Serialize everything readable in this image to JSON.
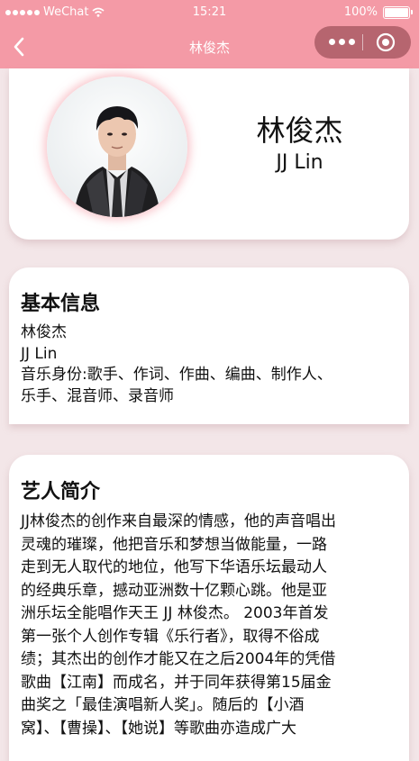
{
  "status_bar": {
    "carrier": "WeChat",
    "time": "15:21",
    "battery": "100%"
  },
  "navbar": {
    "title": "林俊杰"
  },
  "profile": {
    "name_zh": "林俊杰",
    "name_en": "JJ Lin"
  },
  "basic_info": {
    "heading": "基本信息",
    "lines": [
      "林俊杰",
      "JJ Lin",
      "音乐身份:歌手、作词、作曲、编曲、制作人、",
      "乐手、混音师、录音师"
    ]
  },
  "intro": {
    "heading": "艺人简介",
    "lines": [
      "JJ林俊杰的创作来自最深的情感，他的声音唱出",
      "灵魂的璀璨，他把音乐和梦想当做能量，一路",
      "走到无人取代的地位，他写下华语乐坛最动人",
      "的经典乐章，撼动亚洲数十亿颗心跳。他是亚",
      "洲乐坛全能唱作天王 JJ 林俊杰。 2003年首发",
      "第一张个人创作专辑《乐行者》，取得不俗成",
      "绩；其杰出的创作才能又在之后2004年的凭借",
      "歌曲【江南】而成名，并于同年获得第15届金",
      "曲奖之「最佳演唱新人奖」。随后的【小酒",
      "窝】、【曹操】、【她说】等歌曲亦造成广大"
    ]
  },
  "colors": {
    "accent": "#f49aa6",
    "capsule": "#b6656f",
    "background": "#f3e6e8"
  },
  "icons": {
    "signal": "signal-dots-icon",
    "wifi": "wifi-icon",
    "battery": "battery-icon",
    "back": "back-arrow-icon",
    "more": "more-dots-icon",
    "close": "close-circle-icon"
  }
}
